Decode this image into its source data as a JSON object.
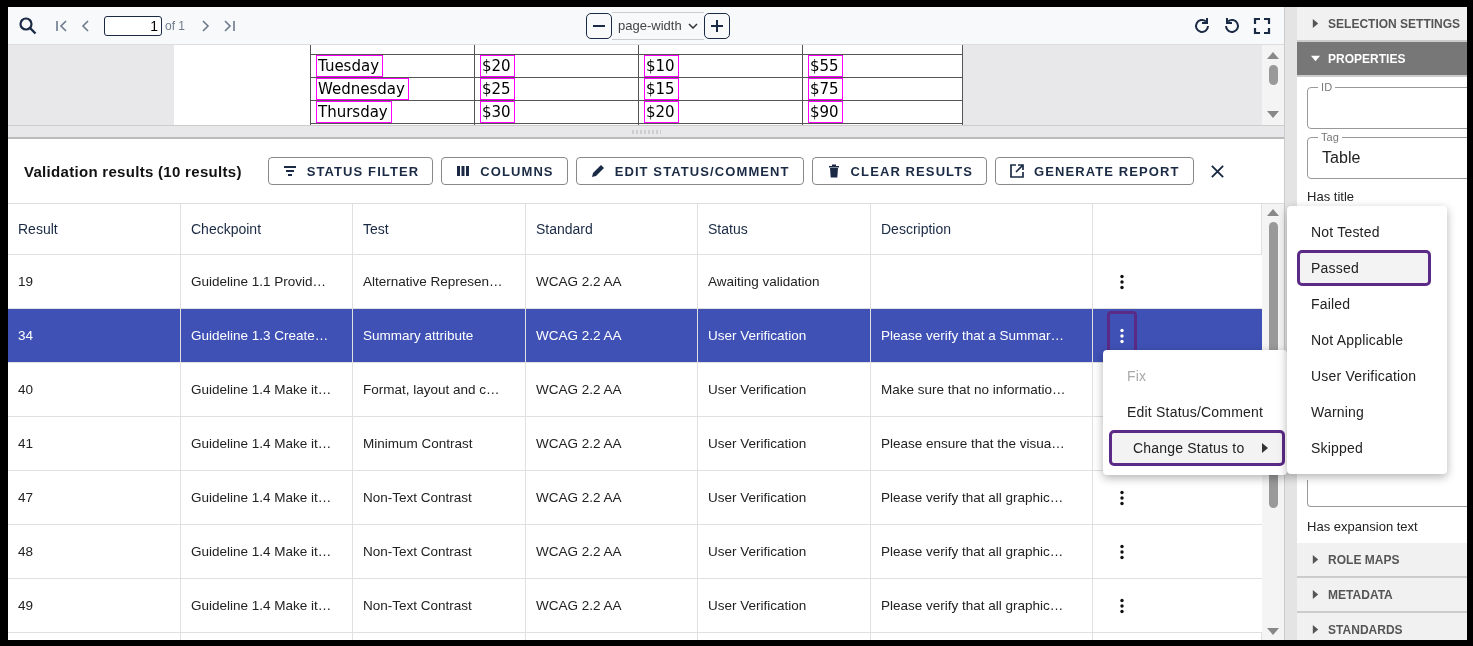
{
  "viewer_toolbar": {
    "page_number": "1",
    "page_count": "of 1",
    "zoom_mode": "page-width"
  },
  "document_table": {
    "rows": [
      {
        "cells": [
          "Tuesday",
          "$20",
          "$10",
          "$55"
        ]
      },
      {
        "cells": [
          "Wednesday",
          "$25",
          "$15",
          "$75"
        ]
      },
      {
        "cells": [
          "Thursday",
          "$30",
          "$20",
          "$90"
        ]
      }
    ]
  },
  "results": {
    "title": "Validation results (10 results)",
    "actions": [
      {
        "label": "STATUS FILTER",
        "kind": "filter"
      },
      {
        "label": "COLUMNS",
        "kind": "columns"
      },
      {
        "label": "EDIT STATUS/COMMENT",
        "kind": "edit"
      },
      {
        "label": "CLEAR RESULTS",
        "kind": "clear"
      },
      {
        "label": "GENERATE REPORT",
        "kind": "report"
      }
    ],
    "columns": [
      "Result",
      "Checkpoint",
      "Test",
      "Standard",
      "Status",
      "Description"
    ],
    "rows": [
      {
        "cells": [
          "19",
          "Guideline 1.1 Provid…",
          "Alternative Represen…",
          "WCAG 2.2 AA",
          "Awaiting validation",
          ""
        ],
        "selected": false
      },
      {
        "cells": [
          "34",
          "Guideline 1.3 Create…",
          "Summary attribute",
          "WCAG 2.2 AA",
          "User Verification",
          "Please verify that a Summar…"
        ],
        "selected": true,
        "menu_highlighted": true
      },
      {
        "cells": [
          "40",
          "Guideline 1.4 Make it…",
          "Format, layout and c…",
          "WCAG 2.2 AA",
          "User Verification",
          "Make sure that no informatio…"
        ],
        "selected": false
      },
      {
        "cells": [
          "41",
          "Guideline 1.4 Make it…",
          "Minimum Contrast",
          "WCAG 2.2 AA",
          "User Verification",
          "Please ensure that the visua…"
        ],
        "selected": false
      },
      {
        "cells": [
          "47",
          "Guideline 1.4 Make it…",
          "Non-Text Contrast",
          "WCAG 2.2 AA",
          "User Verification",
          "Please verify that all graphic…"
        ],
        "selected": false
      },
      {
        "cells": [
          "48",
          "Guideline 1.4 Make it…",
          "Non-Text Contrast",
          "WCAG 2.2 AA",
          "User Verification",
          "Please verify that all graphic…"
        ],
        "selected": false
      },
      {
        "cells": [
          "49",
          "Guideline 1.4 Make it…",
          "Non-Text Contrast",
          "WCAG 2.2 AA",
          "User Verification",
          "Please verify that all graphic…"
        ],
        "selected": false
      }
    ]
  },
  "context_menu": {
    "items": [
      {
        "label": "Fix",
        "disabled": true,
        "highlighted": false,
        "submenu": false
      },
      {
        "label": "Edit Status/Comment",
        "disabled": false,
        "highlighted": false,
        "submenu": false
      },
      {
        "label": "Change Status to",
        "disabled": false,
        "highlighted": true,
        "submenu": true
      }
    ]
  },
  "status_submenu": {
    "items": [
      {
        "label": "Not Tested",
        "highlighted": false
      },
      {
        "label": "Passed",
        "highlighted": true
      },
      {
        "label": "Failed",
        "highlighted": false
      },
      {
        "label": "Not Applicable",
        "highlighted": false
      },
      {
        "label": "User Verification",
        "highlighted": false
      },
      {
        "label": "Warning",
        "highlighted": false
      },
      {
        "label": "Skipped",
        "highlighted": false
      }
    ]
  },
  "sidebar": {
    "sections": [
      {
        "title": "SELECTION SETTINGS",
        "expanded": false
      },
      {
        "title": "PROPERTIES",
        "expanded": true
      },
      {
        "title": "ROLE MAPS",
        "expanded": false
      },
      {
        "title": "METADATA",
        "expanded": false
      },
      {
        "title": "STANDARDS",
        "expanded": false
      }
    ],
    "properties": [
      {
        "kind": "field",
        "label": "ID"
      },
      {
        "kind": "field",
        "label": "Tag",
        "value": "Table"
      },
      {
        "kind": "text",
        "label": "Has title"
      },
      {
        "kind": "bigfield"
      },
      {
        "kind": "text",
        "label": "Has expansion text"
      }
    ]
  }
}
